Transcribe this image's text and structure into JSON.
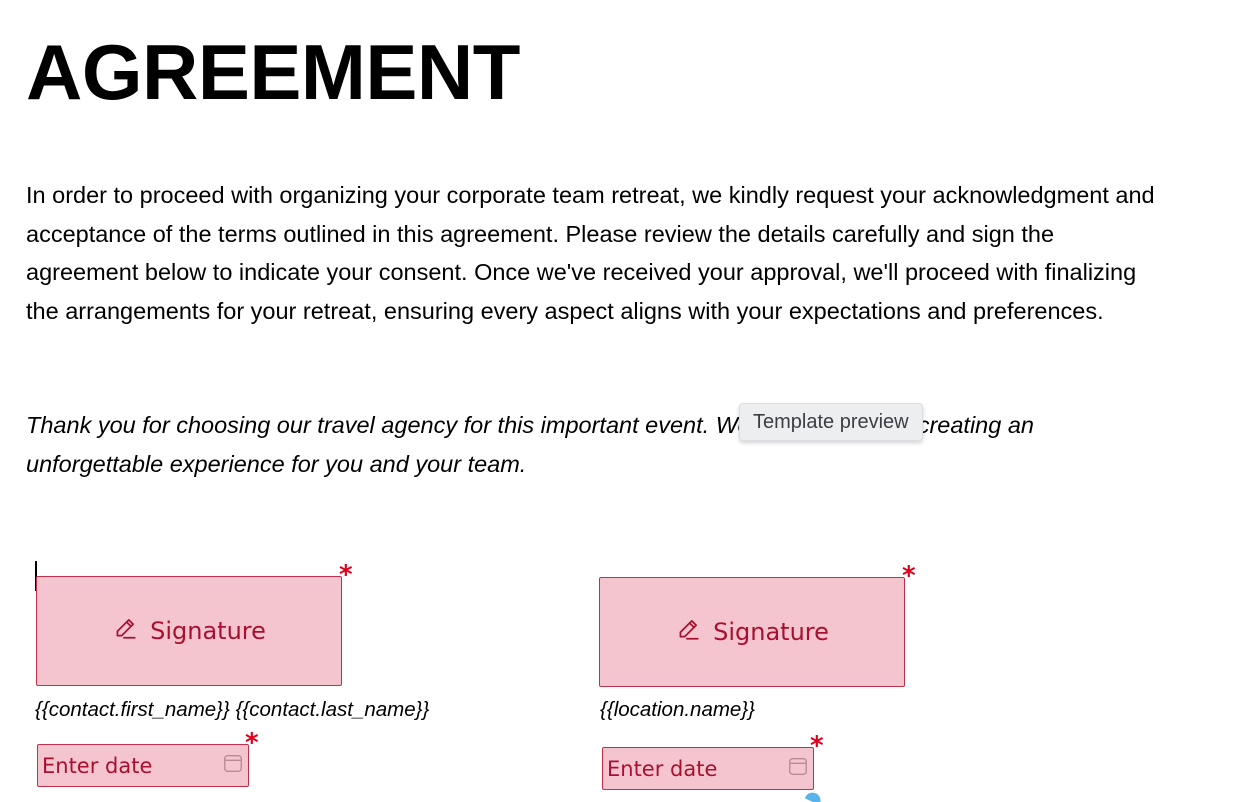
{
  "document": {
    "title": "AGREEMENT",
    "paragraph_1": "In order to proceed with organizing your corporate team retreat, we kindly request your acknowledgment and acceptance of the terms outlined in this agreement. Please review the details carefully and sign the agreement below to indicate your consent. Once we've received your approval, we'll proceed with finalizing the arrangements for your retreat, ensuring every aspect aligns with your expectations and preferences.",
    "paragraph_2": "Thank you for choosing our travel agency for this important event. We look forward to creating an unforgettable experience for you and your team."
  },
  "tooltip": {
    "text": "Template preview"
  },
  "signers": [
    {
      "signature_label": "Signature",
      "signature_icon": "pen-icon",
      "name_label": "{{contact.first_name}} {{contact.last_name}}",
      "date_placeholder": "Enter date",
      "date_icon": "calendar-icon",
      "required_mark": "*"
    },
    {
      "signature_label": "Signature",
      "signature_icon": "pen-icon",
      "name_label": "{{location.name}}",
      "date_placeholder": "Enter date",
      "date_icon": "calendar-icon",
      "required_mark": "*"
    }
  ],
  "colors": {
    "field_fill": "#f5c5cf",
    "field_border": "#c0304c",
    "field_text": "#a8102f",
    "required": "#e0001b"
  }
}
